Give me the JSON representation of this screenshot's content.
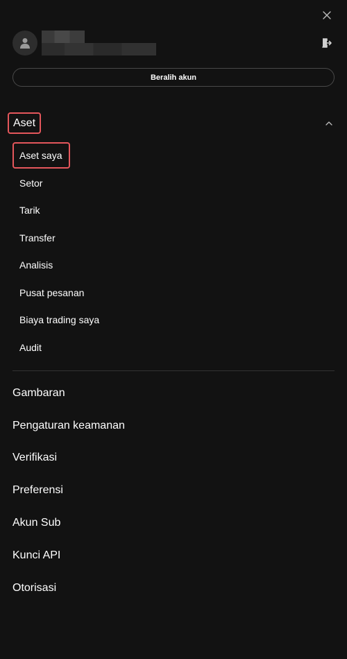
{
  "header": {
    "close_icon": "close-icon",
    "logout_icon": "logout-icon",
    "avatar_icon": "user-icon"
  },
  "profile": {
    "switch_account_label": "Beralih akun"
  },
  "assets_section": {
    "title": "Aset",
    "expanded": true,
    "chevron_icon": "chevron-up-icon",
    "items": [
      {
        "label": "Aset saya",
        "active": true
      },
      {
        "label": "Setor",
        "active": false
      },
      {
        "label": "Tarik",
        "active": false
      },
      {
        "label": "Transfer",
        "active": false
      },
      {
        "label": "Analisis",
        "active": false
      },
      {
        "label": "Pusat pesanan",
        "active": false
      },
      {
        "label": "Biaya trading saya",
        "active": false
      },
      {
        "label": "Audit",
        "active": false
      }
    ]
  },
  "menu": {
    "items": [
      {
        "label": "Gambaran"
      },
      {
        "label": "Pengaturan keamanan"
      },
      {
        "label": "Verifikasi"
      },
      {
        "label": "Preferensi"
      },
      {
        "label": "Akun Sub"
      },
      {
        "label": "Kunci API"
      },
      {
        "label": "Otorisasi"
      }
    ]
  },
  "colors": {
    "background": "#121212",
    "highlight_border": "#e5575c",
    "text": "#ffffff"
  }
}
